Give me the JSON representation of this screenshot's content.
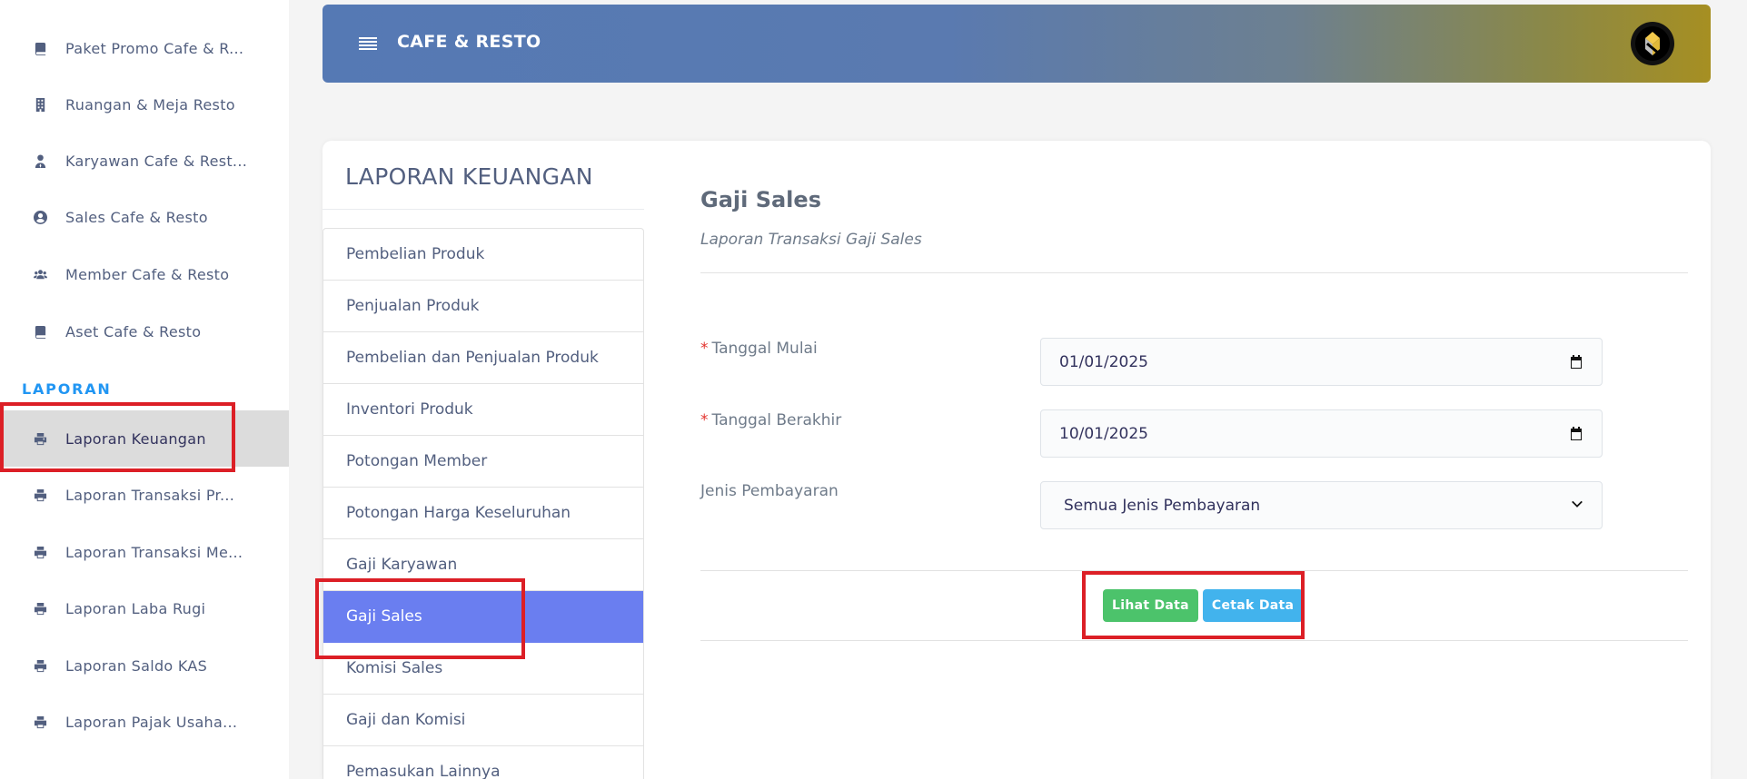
{
  "sidebar": {
    "items": [
      {
        "label": "Paket Promo Cafe & R...",
        "icon": "book-icon"
      },
      {
        "label": "Ruangan & Meja Resto",
        "icon": "building-icon"
      },
      {
        "label": "Karyawan Cafe & Rest...",
        "icon": "user-tie-icon"
      },
      {
        "label": "Sales Cafe & Resto",
        "icon": "user-circle-icon"
      },
      {
        "label": "Member Cafe & Resto",
        "icon": "users-icon"
      },
      {
        "label": "Aset Cafe & Resto",
        "icon": "book-icon"
      }
    ],
    "section_heading": "LAPORAN",
    "report_items": [
      {
        "label": "Laporan Keuangan",
        "icon": "print-icon",
        "active": true
      },
      {
        "label": "Laporan Transaksi Pr...",
        "icon": "print-icon"
      },
      {
        "label": "Laporan Transaksi Me...",
        "icon": "print-icon"
      },
      {
        "label": "Laporan Laba Rugi",
        "icon": "print-icon"
      },
      {
        "label": "Laporan Saldo KAS",
        "icon": "print-icon"
      },
      {
        "label": "Laporan Pajak Usaha...",
        "icon": "print-icon"
      }
    ]
  },
  "header": {
    "brand": "CAFE & RESTO",
    "menu_icon": "hamburger-icon",
    "avatar_icon": "logo-avatar-icon"
  },
  "card": {
    "title": "LAPORAN KEUANGAN",
    "menu": [
      "Pembelian Produk",
      "Penjualan Produk",
      "Pembelian dan Penjualan Produk",
      "Inventori Produk",
      "Potongan Member",
      "Potongan Harga Keseluruhan",
      "Gaji Karyawan",
      "Gaji Sales",
      "Komisi Sales",
      "Gaji dan Komisi",
      "Pemasukan Lainnya"
    ],
    "active_menu": "Gaji Sales"
  },
  "form": {
    "title": "Gaji Sales",
    "subtitle": "Laporan Transaksi Gaji Sales",
    "start_label": "Tanggal Mulai",
    "start_value": "01/01/2025",
    "end_label": "Tanggal Berakhir",
    "end_value": "10/01/2025",
    "payment_label": "Jenis Pembayaran",
    "payment_value": "Semua Jenis Pembayaran",
    "required_mark": "*",
    "view_button": "Lihat Data",
    "print_button": "Cetak Data"
  },
  "colors": {
    "accent_active": "#6a7ef0",
    "section_heading": "#2196f3",
    "button_green": "#4cc36b",
    "button_blue": "#42b3ed",
    "highlight_red": "#dc1f26"
  }
}
